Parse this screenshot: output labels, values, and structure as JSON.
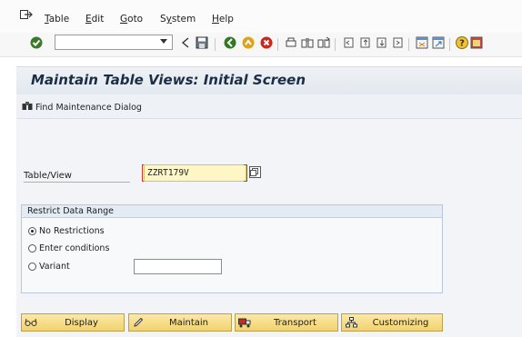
{
  "menubar": {
    "items": [
      {
        "label": "Table",
        "ul": "T"
      },
      {
        "label": "Edit",
        "ul": "E"
      },
      {
        "label": "Goto",
        "ul": "G"
      },
      {
        "label": "System",
        "ul": "y"
      },
      {
        "label": "Help",
        "ul": "H"
      }
    ]
  },
  "toolbar": {
    "command_value": "",
    "icons": [
      "enter-icon",
      "back-arrow-icon",
      "save-icon",
      "back-icon",
      "exit-icon",
      "cancel-icon",
      "print-icon",
      "find-icon",
      "find-next-icon",
      "first-page-icon",
      "previous-page-icon",
      "next-page-icon",
      "last-page-icon",
      "create-session-icon",
      "create-shortcut-icon",
      "help-icon",
      "customize-layout-icon"
    ]
  },
  "title": "Maintain Table Views: Initial Screen",
  "app_toolbar": {
    "find_label": "Find Maintenance Dialog"
  },
  "form": {
    "table_view_label": "Table/View",
    "table_view_value": "ZZRT179V"
  },
  "restrict": {
    "header": "Restrict Data Range",
    "options": [
      {
        "label": "No Restrictions",
        "selected": true
      },
      {
        "label": "Enter conditions",
        "selected": false
      },
      {
        "label": "Variant",
        "selected": false
      }
    ],
    "variant_value": ""
  },
  "buttons": {
    "display": "Display",
    "maintain": "Maintain",
    "transport": "Transport",
    "customizing": "Customizing"
  },
  "colors": {
    "title": "#1b2e45",
    "button_bg": "#f2d26e",
    "required_mark": "#d8342c",
    "input_highlight": "#fff6c6"
  }
}
